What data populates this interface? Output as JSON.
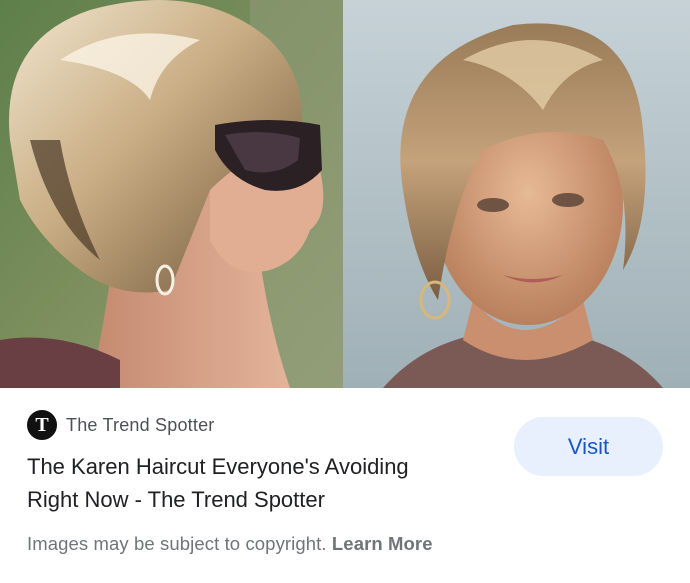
{
  "source": {
    "logo_letter": "T",
    "name": "The Trend Spotter"
  },
  "result": {
    "title_line1": "The Karen Haircut Everyone's Avoiding",
    "title_line2": "Right Now - The Trend Spotter"
  },
  "actions": {
    "visit_label": "Visit"
  },
  "footer": {
    "copyright_text": "Images may be subject to copyright.",
    "learn_more_label": "Learn More"
  },
  "colors": {
    "visit_bg": "#e8f0fe",
    "visit_text": "#1a55c4",
    "title_text": "#202124",
    "muted_text": "#70757a"
  }
}
